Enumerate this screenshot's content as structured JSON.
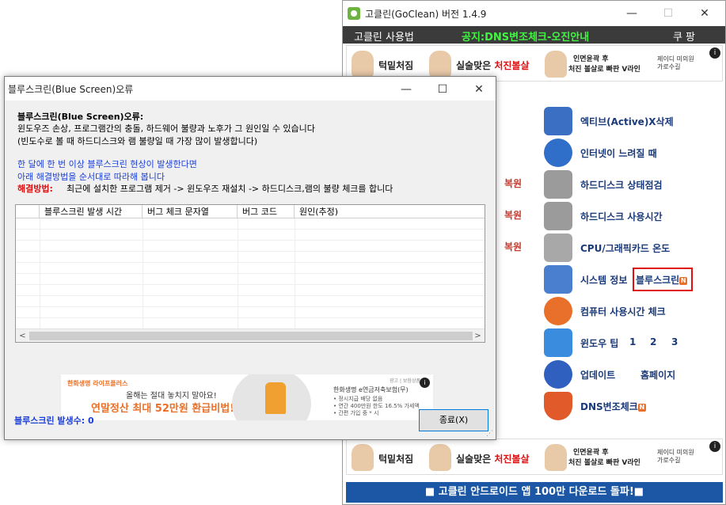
{
  "main_window": {
    "title": "고클린(GoClean) 버전 1.4.9",
    "controls": {
      "minimize": "—",
      "maximize": "☐",
      "close": "✕"
    },
    "usage_label": "고클린 사용법",
    "notice": "공지:DNS변조체크-오진안내",
    "coupang_label": "쿠 팡",
    "ad": {
      "item1": "턱밑처짐",
      "item2_a": "실술맞은 ",
      "item2_b": "처진볼살",
      "item3_line1": "인면윤곽 후",
      "item3_line2": "처진 볼살로 빠판 V라인",
      "clinic_line1": "제이디 미의원",
      "clinic_line2": "가로수길",
      "info": "i"
    },
    "restore_labels": [
      "복원",
      "복원",
      "복원"
    ],
    "menu": [
      {
        "label": "엑티브(Active)X삭제",
        "icon": "activex-icon",
        "color": "#3a6fc4"
      },
      {
        "label": "인터넷이 느려질 때",
        "icon": "internet-slow-icon",
        "color": "#2f6ec9"
      },
      {
        "label": "하드디스크 상태점검",
        "icon": "disk-check-icon",
        "color": "#8c8c8c"
      },
      {
        "label": "하드디스크 사용시간",
        "icon": "disk-time-icon",
        "color": "#8c8c8c"
      },
      {
        "label": "CPU/그래픽카드 온도",
        "icon": "thermometer-icon",
        "color": "#9a9a9a"
      },
      {
        "label": "시스템 정보",
        "icon": "computer-icon",
        "color": "#4a7ecf"
      },
      {
        "label": "컴퓨터 사용시간 체크",
        "icon": "clock-icon",
        "color": "#e8702a"
      },
      {
        "label": "윈도우 팁",
        "icon": "windows-tip-icon",
        "color": "#3a8dde"
      },
      {
        "label": "업데이트",
        "icon": "update-icon",
        "color": "#2f5fbf"
      },
      {
        "label": "DNS변조체크",
        "icon": "shield-icon",
        "color": "#e05a2a"
      }
    ],
    "bluescreen_label": "블루스크린",
    "n_badge": "N",
    "tips": [
      "1",
      "2",
      "3"
    ],
    "homepage_label": "홈페이지",
    "bottom_banner": "■ 고클린 안드로이드 앱 100만 다운로드 돌파!■"
  },
  "bluescreen_dialog": {
    "title": "블루스크린(Blue Screen)오류",
    "controls": {
      "minimize": "—",
      "maximize": "☐",
      "close": "✕"
    },
    "heading": "블루스크린(Blue Screen)오류:",
    "desc1": "윈도우즈 손상, 프로그램간의 충돌, 하드웨어 불량과 노후가 그 원인일 수 있습니다",
    "desc2": "(빈도수로 볼 때 하드디스크와 램 불량일 때 가장 많이 발생합니다)",
    "advice1": "한 달에 한 번 이상 블루스크린 현상이 발생한다면",
    "advice2": "아래 해결방법을 순서대로 따라해 봅니다",
    "solution_label": "해결방법:",
    "solution_text": "최근에 설치한 프로그램 제거 -> 윈도우즈 재설치 -> 하드디스크,램의 불량 체크를 합니다",
    "columns": [
      "",
      "블루스크린 발생 시간",
      "버그 체크 문자열",
      "버그 코드",
      "원인(추정)"
    ],
    "rows": [],
    "scroll_left": "<",
    "scroll_right": ">",
    "ad": {
      "brand": "한화생명 라이프플러스",
      "line1": "올해는 절대 놓치지 말아요!",
      "line2": "연말정산 최대 52만원 환급비법!",
      "right1": "한화생명 e연금저축보험(무)",
      "right2": "• 정시지급 배당 없음",
      "right3": "• 연간 400만원 한도 16.5% 가세액",
      "right4": "• 간편 가입 중 * 시",
      "tiny": "광고 | 보험상품",
      "info": "i"
    },
    "count_label": "블루스크린 발생수: 0",
    "close_button": "종료(X)"
  }
}
